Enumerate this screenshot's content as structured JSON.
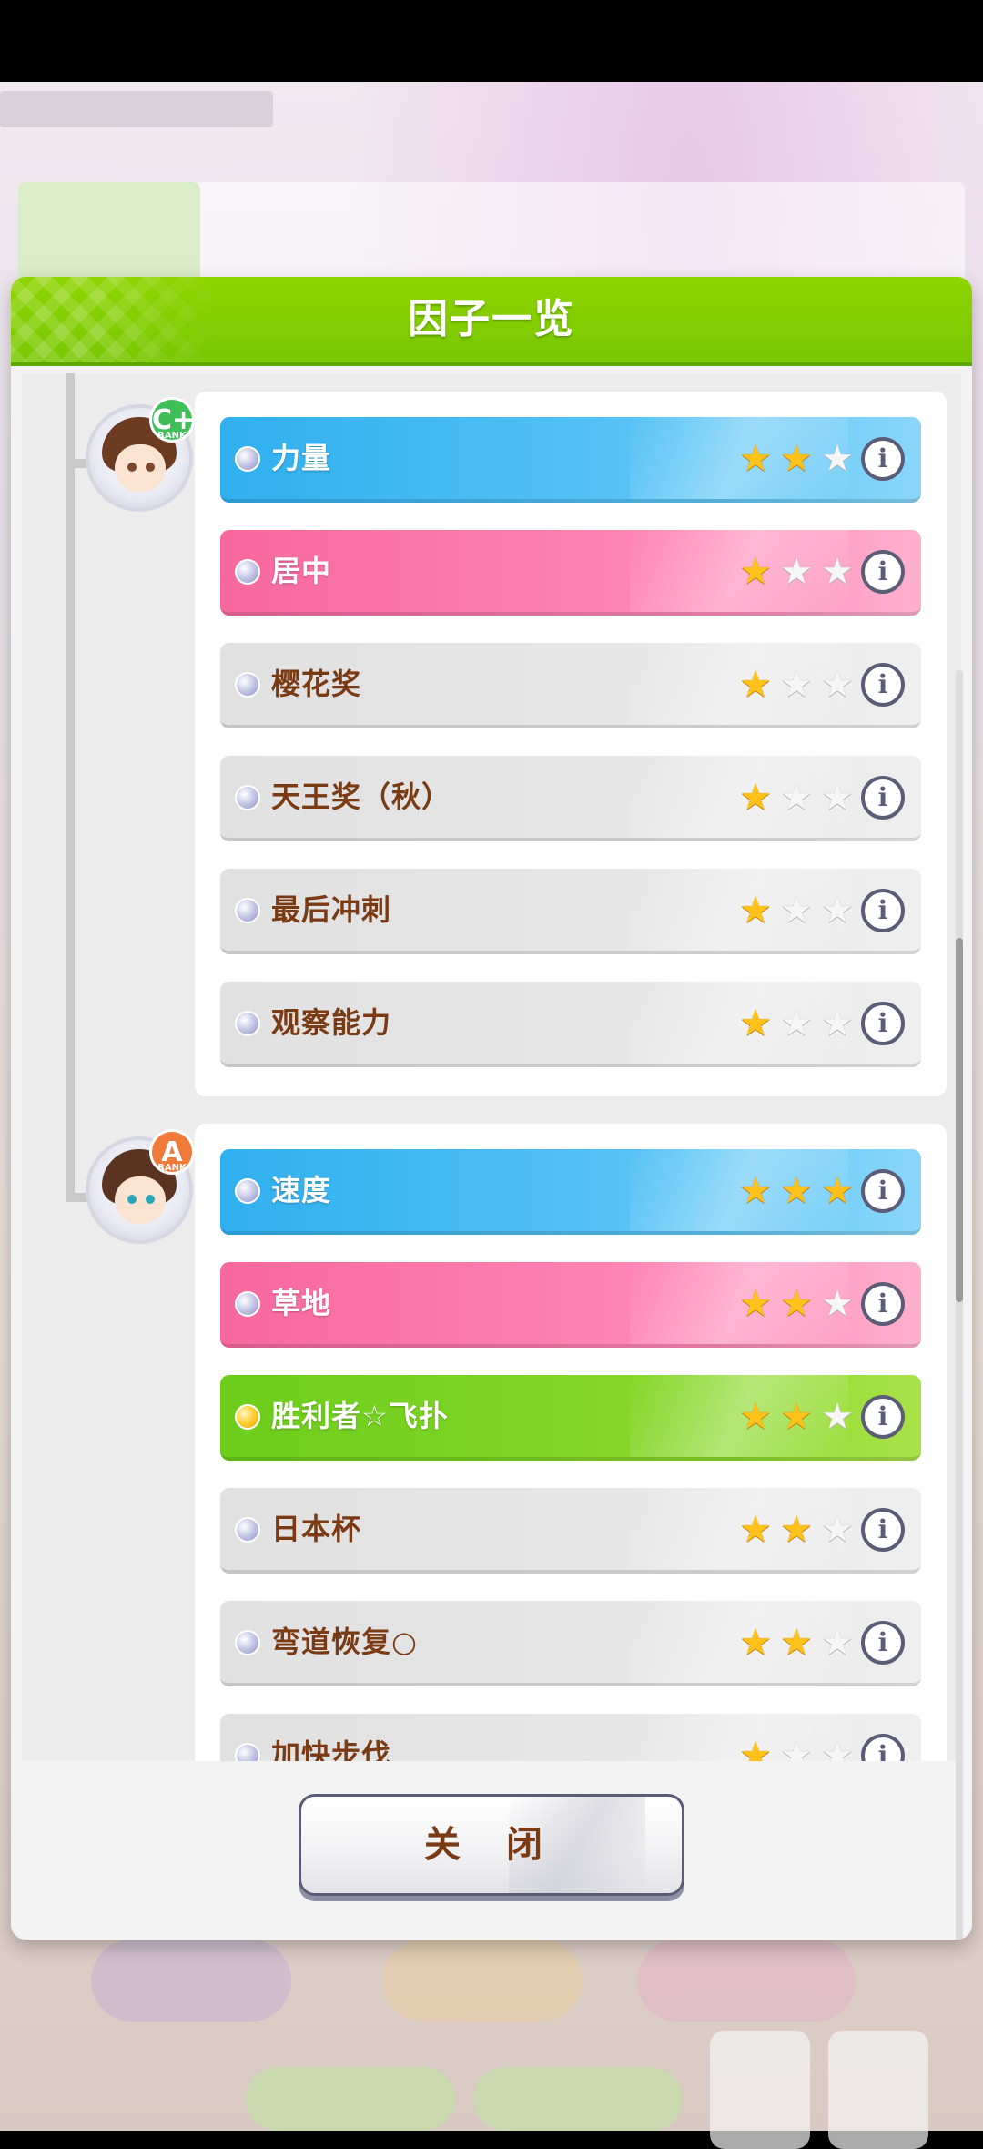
{
  "dialog": {
    "title": "因子一览",
    "close_label": "关 闭"
  },
  "groups": [
    {
      "avatar_rank": "C+",
      "rank_caption": "RANK",
      "factors": [
        {
          "name": "力量",
          "color": "blue",
          "stars": 2,
          "max_stars": 3
        },
        {
          "name": "居中",
          "color": "pink",
          "stars": 1,
          "max_stars": 3
        },
        {
          "name": "樱花奖",
          "color": "gray",
          "stars": 1,
          "max_stars": 3
        },
        {
          "name": "天王奖（秋）",
          "color": "gray",
          "stars": 1,
          "max_stars": 3
        },
        {
          "name": "最后冲刺",
          "color": "gray",
          "stars": 1,
          "max_stars": 3
        },
        {
          "name": "观察能力",
          "color": "gray",
          "stars": 1,
          "max_stars": 3
        }
      ]
    },
    {
      "avatar_rank": "A",
      "rank_caption": "RANK",
      "factors": [
        {
          "name": "速度",
          "color": "blue",
          "stars": 3,
          "max_stars": 3
        },
        {
          "name": "草地",
          "color": "pink",
          "stars": 2,
          "max_stars": 3
        },
        {
          "name": "胜利者☆飞扑",
          "color": "green",
          "stars": 2,
          "max_stars": 3
        },
        {
          "name": "日本杯",
          "color": "gray",
          "stars": 2,
          "max_stars": 3
        },
        {
          "name": "弯道恢复○",
          "color": "gray",
          "stars": 2,
          "max_stars": 3
        },
        {
          "name": "加快步伐",
          "color": "gray",
          "stars": 1,
          "max_stars": 3
        }
      ]
    }
  ],
  "colors": {
    "header_green": "#8fd400",
    "blue": "#2fb0ee",
    "pink": "#f7689e",
    "green": "#6ccd1a",
    "gray": "#e1e1e1",
    "label_brown": "#7a3a14",
    "star_on": "#ffc21a"
  },
  "icons": {
    "info": "info-icon",
    "star_filled": "star-filled-icon",
    "star_empty": "star-empty-icon",
    "orb": "factor-orb-icon"
  }
}
